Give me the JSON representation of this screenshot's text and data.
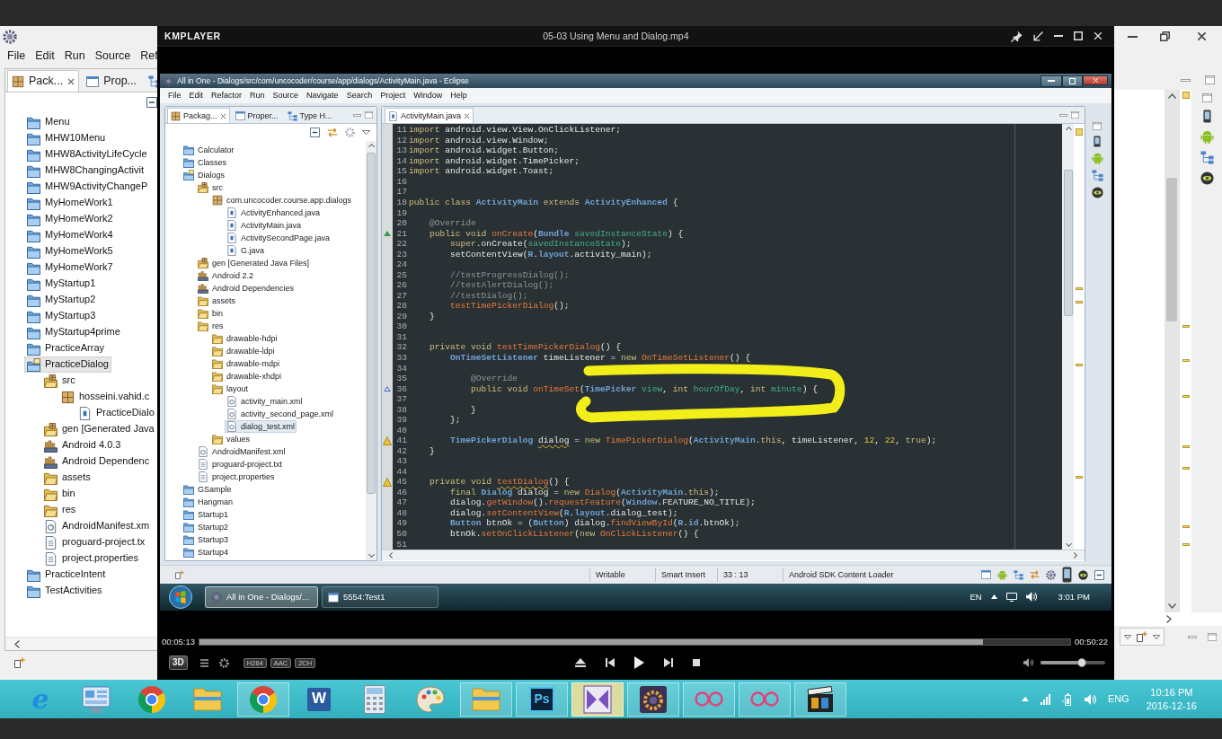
{
  "outer_eclipse": {
    "menu": [
      "File",
      "Edit",
      "Run",
      "Source",
      "Ref"
    ],
    "view_tabs": [
      {
        "label": "Pack...",
        "selected": true
      },
      {
        "label": "Prop...",
        "selected": false
      },
      {
        "selected": false
      }
    ],
    "tree": [
      {
        "label": "Menu",
        "kind": "project",
        "selected": false
      },
      {
        "label": "MHW10Menu",
        "kind": "project",
        "selected": false
      },
      {
        "label": "MHW8ActivityLifeCycle",
        "kind": "project",
        "selected": false
      },
      {
        "label": "MHW8ChangingActivit",
        "kind": "project",
        "selected": false
      },
      {
        "label": "MHW9ActivityChangeP",
        "kind": "project",
        "selected": false
      },
      {
        "label": "MyHomeWork1",
        "kind": "project",
        "selected": false
      },
      {
        "label": "MyHomeWork2",
        "kind": "project",
        "selected": false
      },
      {
        "label": "MyHomeWork4",
        "kind": "project",
        "selected": false
      },
      {
        "label": "MyHomeWork5",
        "kind": "project",
        "selected": false
      },
      {
        "label": "MyHomeWork7",
        "kind": "project",
        "selected": false
      },
      {
        "label": "MyStartup1",
        "kind": "project",
        "selected": false
      },
      {
        "label": "MyStartup2",
        "kind": "project",
        "selected": false
      },
      {
        "label": "MyStartup3",
        "kind": "project",
        "selected": false
      },
      {
        "label": "MyStartup4prime",
        "kind": "project",
        "selected": false
      },
      {
        "label": "PracticeArray",
        "kind": "project",
        "selected": false
      },
      {
        "label": "PracticeDialog",
        "kind": "open_project",
        "selected": true,
        "children": [
          {
            "label": "src",
            "kind": "source_folder",
            "selected": false,
            "children": [
              {
                "label": "hosseini.vahid.c",
                "kind": "package",
                "selected": false,
                "children": [
                  {
                    "label": "PracticeDialo",
                    "kind": "java",
                    "selected": false
                  }
                ]
              }
            ]
          },
          {
            "label": "gen [Generated Java",
            "kind": "source_folder",
            "selected": false
          },
          {
            "label": "Android 4.0.3",
            "kind": "library",
            "selected": false
          },
          {
            "label": "Android Dependenc",
            "kind": "library",
            "selected": false
          },
          {
            "label": "assets",
            "kind": "folder",
            "selected": false
          },
          {
            "label": "bin",
            "kind": "folder",
            "selected": false
          },
          {
            "label": "res",
            "kind": "folder",
            "selected": false
          },
          {
            "label": "AndroidManifest.xm",
            "kind": "xml",
            "selected": false
          },
          {
            "label": "proguard-project.tx",
            "kind": "text",
            "selected": false
          },
          {
            "label": "project.properties",
            "kind": "text",
            "selected": false
          }
        ]
      },
      {
        "label": "PracticeIntent",
        "kind": "project",
        "selected": false
      },
      {
        "label": "TestActivities",
        "kind": "project",
        "selected": false
      }
    ]
  },
  "player": {
    "logo": "KMPLAYER",
    "title": "05-03 Using Menu and Dialog.mp4",
    "video": {
      "window_title": "All in One - Dialogs/src/com/uncocoder/course/app/dialogs/ActivityMain.java - Eclipse",
      "menu": [
        "File",
        "Edit",
        "Refactor",
        "Run",
        "Source",
        "Navigate",
        "Search",
        "Project",
        "Window",
        "Help"
      ],
      "view_tabs": [
        {
          "label": "Packag...",
          "selected": true
        },
        {
          "label": "Proper...",
          "selected": false
        },
        {
          "label": "Type H...",
          "selected": false
        }
      ],
      "tree": [
        {
          "label": "Calculator",
          "kind": "project",
          "selected": false
        },
        {
          "label": "Classes",
          "kind": "project",
          "selected": false
        },
        {
          "label": "Dialogs",
          "kind": "open_project",
          "selected": false,
          "children": [
            {
              "label": "src",
              "kind": "source_folder",
              "selected": false,
              "children": [
                {
                  "label": "com.uncocoder.course.app.dialogs",
                  "kind": "package",
                  "selected": false,
                  "children": [
                    {
                      "label": "ActivityEnhanced.java",
                      "kind": "java",
                      "selected": false
                    },
                    {
                      "label": "ActivityMain.java",
                      "kind": "java",
                      "selected": false
                    },
                    {
                      "label": "ActivitySecondPage.java",
                      "kind": "java",
                      "selected": false
                    },
                    {
                      "label": "G.java",
                      "kind": "java",
                      "selected": false
                    }
                  ]
                }
              ]
            },
            {
              "label": "gen [Generated Java Files]",
              "kind": "source_folder",
              "selected": false
            },
            {
              "label": "Android 2.2",
              "kind": "library",
              "selected": false
            },
            {
              "label": "Android Dependencies",
              "kind": "library",
              "selected": false
            },
            {
              "label": "assets",
              "kind": "folder",
              "selected": false
            },
            {
              "label": "bin",
              "kind": "folder",
              "selected": false
            },
            {
              "label": "res",
              "kind": "folder",
              "selected": false,
              "children": [
                {
                  "label": "drawable-hdpi",
                  "kind": "folder",
                  "selected": false
                },
                {
                  "label": "drawable-ldpi",
                  "kind": "folder",
                  "selected": false
                },
                {
                  "label": "drawable-mdpi",
                  "kind": "folder",
                  "selected": false
                },
                {
                  "label": "drawable-xhdpi",
                  "kind": "folder",
                  "selected": false
                },
                {
                  "label": "layout",
                  "kind": "folder",
                  "selected": false,
                  "children": [
                    {
                      "label": "activity_main.xml",
                      "kind": "xml",
                      "selected": false
                    },
                    {
                      "label": "activity_second_page.xml",
                      "kind": "xml",
                      "selected": false
                    },
                    {
                      "label": "dialog_test.xml",
                      "kind": "xml",
                      "selected": true
                    }
                  ]
                },
                {
                  "label": "values",
                  "kind": "folder",
                  "selected": false
                }
              ]
            },
            {
              "label": "AndroidManifest.xml",
              "kind": "xml",
              "selected": false
            },
            {
              "label": "proguard-project.txt",
              "kind": "text",
              "selected": false
            },
            {
              "label": "project.properties",
              "kind": "text",
              "selected": false
            }
          ]
        },
        {
          "label": "GSample",
          "kind": "project",
          "selected": false
        },
        {
          "label": "Hangman",
          "kind": "project",
          "selected": false
        },
        {
          "label": "Startup1",
          "kind": "project",
          "selected": false
        },
        {
          "label": "Startup2",
          "kind": "project",
          "selected": false
        },
        {
          "label": "Startup3",
          "kind": "project",
          "selected": false
        },
        {
          "label": "Startup4",
          "kind": "project",
          "selected": false
        }
      ],
      "editor_tabs": [
        {
          "label": "ActivityMain.java",
          "selected": true
        }
      ],
      "code": [
        {
          "number": "11",
          "kind": "plain",
          "tokens": [
            {
              "kind": "keyword",
              "text": "import"
            },
            {
              "kind": "plain",
              "text": " android.view.View.OnClickListener;"
            }
          ]
        },
        {
          "number": "12",
          "kind": "plain",
          "tokens": [
            {
              "kind": "keyword",
              "text": "import"
            },
            {
              "kind": "plain",
              "text": " android.view.Window;"
            }
          ]
        },
        {
          "number": "13",
          "kind": "plain",
          "tokens": [
            {
              "kind": "keyword",
              "text": "import"
            },
            {
              "kind": "plain",
              "text": " android.widget.Button;"
            }
          ]
        },
        {
          "number": "14",
          "kind": "plain",
          "tokens": [
            {
              "kind": "keyword",
              "text": "import"
            },
            {
              "kind": "plain",
              "text": " android.widget.TimePicker;"
            }
          ]
        },
        {
          "number": "15",
          "kind": "plain",
          "tokens": [
            {
              "kind": "keyword",
              "text": "import"
            },
            {
              "kind": "plain",
              "text": " android.widget.Toast;"
            }
          ]
        },
        {
          "number": "16",
          "kind": "plain"
        },
        {
          "number": "17",
          "kind": "plain"
        },
        {
          "number": "18",
          "kind": "plain",
          "tokens": [
            {
              "kind": "keyword",
              "text": "public class"
            },
            {
              "kind": "type",
              "text": " ActivityMain"
            },
            {
              "kind": "keyword",
              "text": " extends"
            },
            {
              "kind": "type",
              "text": " ActivityEnhanced"
            },
            {
              "kind": "plain",
              "text": " {"
            }
          ]
        },
        {
          "number": "19",
          "kind": "plain"
        },
        {
          "number": "20",
          "kind": "plain",
          "tokens": [
            {
              "kind": "annotation",
              "text": "    @Override"
            }
          ]
        },
        {
          "number": "21",
          "kind": "override",
          "tokens": [
            {
              "kind": "keyword",
              "text": "    public void"
            },
            {
              "kind": "method",
              "text": " onCreate"
            },
            {
              "kind": "plain",
              "text": "("
            },
            {
              "kind": "type",
              "text": "Bundle"
            },
            {
              "kind": "param",
              "text": " savedInstanceState"
            },
            {
              "kind": "plain",
              "text": ") {"
            }
          ]
        },
        {
          "number": "22",
          "kind": "plain",
          "tokens": [
            {
              "kind": "keyword",
              "text": "        super"
            },
            {
              "kind": "plain",
              "text": ".onCreate("
            },
            {
              "kind": "param",
              "text": "savedInstanceState"
            },
            {
              "kind": "plain",
              "text": ");"
            }
          ]
        },
        {
          "number": "23",
          "kind": "plain",
          "tokens": [
            {
              "kind": "plain",
              "text": "        setContentView("
            },
            {
              "kind": "type",
              "text": "R"
            },
            {
              "kind": "plain",
              "text": "."
            },
            {
              "kind": "type",
              "text": "layout"
            },
            {
              "kind": "plain",
              "text": ".activity_main);"
            }
          ]
        },
        {
          "number": "24",
          "kind": "plain"
        },
        {
          "number": "25",
          "kind": "plain",
          "tokens": [
            {
              "kind": "comment",
              "text": "        //testProgressDialog();"
            }
          ]
        },
        {
          "number": "26",
          "kind": "plain",
          "tokens": [
            {
              "kind": "comment",
              "text": "        //testAlertDialog();"
            }
          ]
        },
        {
          "number": "27",
          "kind": "plain",
          "tokens": [
            {
              "kind": "comment",
              "text": "        //testDialog();"
            }
          ]
        },
        {
          "number": "28",
          "kind": "plain",
          "tokens": [
            {
              "kind": "method",
              "text": "        testTimePickerDialog"
            },
            {
              "kind": "plain",
              "text": "();"
            }
          ]
        },
        {
          "number": "29",
          "kind": "plain",
          "tokens": [
            {
              "kind": "plain",
              "text": "    }"
            }
          ]
        },
        {
          "number": "30",
          "kind": "plain"
        },
        {
          "number": "31",
          "kind": "plain"
        },
        {
          "number": "32",
          "kind": "plain",
          "tokens": [
            {
              "kind": "keyword",
              "text": "    private void"
            },
            {
              "kind": "method",
              "text": " testTimePickerDialog"
            },
            {
              "kind": "plain",
              "text": "() {"
            }
          ]
        },
        {
          "number": "33",
          "kind": "plain",
          "tokens": [
            {
              "kind": "type",
              "text": "        OnTimeSetListener"
            },
            {
              "kind": "plain",
              "text": " timeListener = "
            },
            {
              "kind": "keyword",
              "text": "new"
            },
            {
              "kind": "method",
              "text": " OnTimeSetListener"
            },
            {
              "kind": "plain",
              "text": "() {"
            }
          ]
        },
        {
          "number": "34",
          "kind": "plain"
        },
        {
          "number": "35",
          "kind": "plain",
          "tokens": [
            {
              "kind": "annotation",
              "text": "            @Override"
            }
          ]
        },
        {
          "number": "36",
          "kind": "implements",
          "tokens": [
            {
              "kind": "keyword",
              "text": "            public void"
            },
            {
              "kind": "method",
              "text": " onTimeSet"
            },
            {
              "kind": "plain",
              "text": "("
            },
            {
              "kind": "type",
              "text": "TimePicker"
            },
            {
              "kind": "param",
              "text": " view"
            },
            {
              "kind": "plain",
              "text": ", "
            },
            {
              "kind": "keyword",
              "text": "int"
            },
            {
              "kind": "param",
              "text": " hourOfDay"
            },
            {
              "kind": "plain",
              "text": ", "
            },
            {
              "kind": "keyword",
              "text": "int"
            },
            {
              "kind": "param",
              "text": " minute"
            },
            {
              "kind": "plain",
              "text": ") {"
            }
          ]
        },
        {
          "number": "37",
          "kind": "plain"
        },
        {
          "number": "38",
          "kind": "plain",
          "tokens": [
            {
              "kind": "plain",
              "text": "            }"
            }
          ]
        },
        {
          "number": "39",
          "kind": "plain",
          "tokens": [
            {
              "kind": "plain",
              "text": "        };"
            }
          ]
        },
        {
          "number": "40",
          "kind": "plain"
        },
        {
          "number": "41",
          "kind": "warning",
          "tokens": [
            {
              "kind": "type",
              "text": "        TimePickerDialog "
            },
            {
              "kind": "unused",
              "text": "dialog"
            },
            {
              "kind": "plain",
              "text": " = "
            },
            {
              "kind": "keyword",
              "text": "new"
            },
            {
              "kind": "method",
              "text": " TimePickerDialog"
            },
            {
              "kind": "plain",
              "text": "("
            },
            {
              "kind": "type",
              "text": "ActivityMain"
            },
            {
              "kind": "plain",
              "text": "."
            },
            {
              "kind": "keyword",
              "text": "this"
            },
            {
              "kind": "plain",
              "text": ", timeListener, "
            },
            {
              "kind": "number",
              "text": "12"
            },
            {
              "kind": "plain",
              "text": ", "
            },
            {
              "kind": "number",
              "text": "22"
            },
            {
              "kind": "plain",
              "text": ", "
            },
            {
              "kind": "keyword",
              "text": "true"
            },
            {
              "kind": "plain",
              "text": ");"
            }
          ]
        },
        {
          "number": "42",
          "kind": "plain",
          "tokens": [
            {
              "kind": "plain",
              "text": "    }"
            }
          ]
        },
        {
          "number": "43",
          "kind": "plain"
        },
        {
          "number": "44",
          "kind": "plain"
        },
        {
          "number": "45",
          "kind": "warning",
          "tokens": [
            {
              "kind": "keyword",
              "text": "    private void "
            },
            {
              "kind": "unused_method",
              "text": "testDialog"
            },
            {
              "kind": "plain",
              "text": "() {"
            }
          ]
        },
        {
          "number": "46",
          "kind": "plain",
          "tokens": [
            {
              "kind": "keyword",
              "text": "        final"
            },
            {
              "kind": "type",
              "text": " Dialog"
            },
            {
              "kind": "plain",
              "text": " dialog = "
            },
            {
              "kind": "keyword",
              "text": "new"
            },
            {
              "kind": "method",
              "text": " Dialog"
            },
            {
              "kind": "plain",
              "text": "("
            },
            {
              "kind": "type",
              "text": "ActivityMain"
            },
            {
              "kind": "plain",
              "text": "."
            },
            {
              "kind": "keyword",
              "text": "this"
            },
            {
              "kind": "plain",
              "text": ");"
            }
          ]
        },
        {
          "number": "47",
          "kind": "plain",
          "tokens": [
            {
              "kind": "plain",
              "text": "        dialog."
            },
            {
              "kind": "method",
              "text": "getWindow"
            },
            {
              "kind": "plain",
              "text": "()."
            },
            {
              "kind": "method",
              "text": "requestFeature"
            },
            {
              "kind": "plain",
              "text": "("
            },
            {
              "kind": "type",
              "text": "Window"
            },
            {
              "kind": "plain",
              "text": ".FEATURE_NO_TITLE);"
            }
          ]
        },
        {
          "number": "48",
          "kind": "plain",
          "tokens": [
            {
              "kind": "plain",
              "text": "        dialog."
            },
            {
              "kind": "method",
              "text": "setContentView"
            },
            {
              "kind": "plain",
              "text": "("
            },
            {
              "kind": "type",
              "text": "R"
            },
            {
              "kind": "plain",
              "text": "."
            },
            {
              "kind": "type",
              "text": "layout"
            },
            {
              "kind": "plain",
              "text": ".dialog_test);"
            }
          ]
        },
        {
          "number": "49",
          "kind": "plain",
          "tokens": [
            {
              "kind": "type",
              "text": "        Button"
            },
            {
              "kind": "plain",
              "text": " btnOk = ("
            },
            {
              "kind": "type",
              "text": "Button"
            },
            {
              "kind": "plain",
              "text": ") dialog."
            },
            {
              "kind": "method",
              "text": "findViewById"
            },
            {
              "kind": "plain",
              "text": "("
            },
            {
              "kind": "type",
              "text": "R"
            },
            {
              "kind": "plain",
              "text": "."
            },
            {
              "kind": "type",
              "text": "id"
            },
            {
              "kind": "plain",
              "text": ".btnOk);"
            }
          ]
        },
        {
          "number": "50",
          "kind": "plain",
          "tokens": [
            {
              "kind": "plain",
              "text": "        btnOk."
            },
            {
              "kind": "method",
              "text": "setOnClickListener"
            },
            {
              "kind": "plain",
              "text": "("
            },
            {
              "kind": "keyword",
              "text": "new"
            },
            {
              "kind": "method",
              "text": " OnClickListener"
            },
            {
              "kind": "plain",
              "text": "() {"
            }
          ]
        },
        {
          "number": "51",
          "kind": "plain"
        }
      ],
      "status": [
        "Writable",
        "Smart Insert",
        "33 : 13",
        "Android SDK Content Loader"
      ],
      "taskbar": {
        "tasks": [
          {
            "label": "All in One - Dialogs/...",
            "selected": true
          },
          {
            "label": "5554:Test1",
            "selected": false
          }
        ],
        "language": "EN",
        "clock": "3:01 PM"
      }
    },
    "elapsed": "00:05:13",
    "seek": {
      "level": 0.9
    },
    "duration": "00:50:22",
    "mode": "3D",
    "badges": [
      "H264",
      "AAC",
      "2CH"
    ],
    "volume": {
      "level": 0.64
    }
  },
  "taskbar": {
    "apps": [
      {
        "kind": "letter_e",
        "label": "e",
        "running": false,
        "active": false
      },
      {
        "kind": "panel",
        "running": false,
        "active": false
      },
      {
        "kind": "ball",
        "running": false,
        "active": false
      },
      {
        "kind": "folder",
        "running": false,
        "active": false
      },
      {
        "kind": "ball",
        "running": true,
        "active": false
      },
      {
        "kind": "letter_w",
        "label": "W",
        "running": false,
        "active": false
      },
      {
        "kind": "calculator",
        "running": false,
        "active": false
      },
      {
        "kind": "palette",
        "running": false,
        "active": false
      },
      {
        "kind": "folder",
        "running": true,
        "active": false
      },
      {
        "kind": "letter_ps",
        "label": "Ps",
        "running": true,
        "active": false
      },
      {
        "kind": "bowtie",
        "running": true,
        "active": true
      },
      {
        "kind": "gear_tile",
        "running": true,
        "active": false
      },
      {
        "kind": "rings",
        "running": true,
        "active": false
      },
      {
        "kind": "rings",
        "running": true,
        "active": false
      },
      {
        "kind": "clapper",
        "running": true,
        "active": false
      }
    ],
    "language": "ENG",
    "time": "10:16 PM",
    "date": "2016-12-16"
  }
}
